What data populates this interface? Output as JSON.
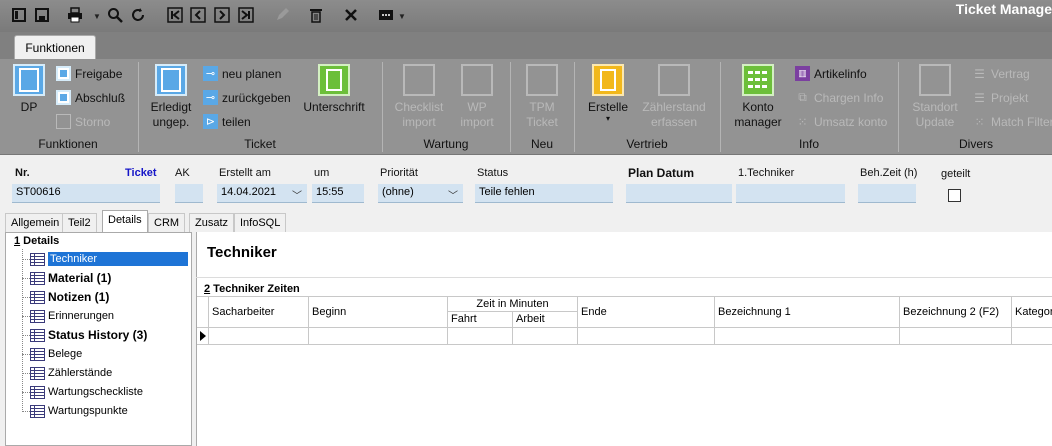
{
  "window": {
    "title": "Ticket Manage"
  },
  "quick_access": [
    {
      "name": "close-doc-icon"
    },
    {
      "name": "save-icon"
    },
    {
      "name": "print-icon"
    },
    {
      "name": "search-icon"
    },
    {
      "name": "refresh-icon"
    },
    {
      "name": "first-icon"
    },
    {
      "name": "prev-icon"
    },
    {
      "name": "next-icon"
    },
    {
      "name": "last-icon"
    },
    {
      "name": "edit-icon"
    },
    {
      "name": "delete-icon"
    },
    {
      "name": "close-icon"
    },
    {
      "name": "more-icon"
    }
  ],
  "ribbon": {
    "tab_label": "Funktionen",
    "groups": {
      "funktionen": {
        "label": "Funktionen",
        "dp": "DP",
        "freigabe": "Freigabe",
        "abschluss": "Abschluß",
        "storno": "Storno"
      },
      "ticket": {
        "label": "Ticket",
        "erledigt_1": "Erledigt",
        "erledigt_2": "ungep.",
        "neu_planen": "neu planen",
        "zurueckgeben": "zurückgeben",
        "teilen": "teilen",
        "unterschrift": "Unterschrift"
      },
      "wartung": {
        "label": "Wartung",
        "checklist_1": "Checklist",
        "checklist_2": "import",
        "wp_1": "WP",
        "wp_2": "import"
      },
      "neu": {
        "label": "Neu",
        "tpm_1": "TPM",
        "tpm_2": "Ticket"
      },
      "vertrieb": {
        "label": "Vertrieb",
        "erstelle": "Erstelle",
        "erstelle_arrow": "▾",
        "zaehler_1": "Zählerstand",
        "zaehler_2": "erfassen"
      },
      "info": {
        "label": "Info",
        "konto_1": "Konto",
        "konto_2": "manager",
        "artikelinfo": "Artikelinfo",
        "chargen": "Chargen Info",
        "umsatz": "Umsatz konto"
      },
      "divers": {
        "label": "Divers",
        "standort_1": "Standort",
        "standort_2": "Update",
        "vertrag": "Vertrag",
        "projekt": "Projekt",
        "match": "Match Filter"
      }
    }
  },
  "header": {
    "nr_label": "Nr.",
    "nr_value": "ST00616",
    "ticket_label": "Ticket",
    "ak_label": "AK",
    "ak_value": "",
    "erstellt_label": "Erstellt am",
    "erstellt_value": "14.04.2021",
    "um_label": "um",
    "um_value": "15:55",
    "prio_label": "Priorität",
    "prio_value": "(ohne)",
    "status_label": "Status",
    "status_value": "Teile fehlen",
    "plan_label": "Plan Datum",
    "plan_value": "",
    "techniker_label": "1.Techniker",
    "techniker_value": "",
    "behzeit_label": "Beh.Zeit (h)",
    "behzeit_value": "",
    "geteilt_label": "geteilt"
  },
  "tabs": [
    "Allgemein",
    "Teil2",
    "Details",
    "CRM",
    "Zusatz",
    "InfoSQL"
  ],
  "tree": {
    "title_num": "1",
    "title": " Details",
    "items": [
      {
        "label": "Techniker"
      },
      {
        "label": "Material (1)"
      },
      {
        "label": "Notizen (1)"
      },
      {
        "label": "Erinnerungen"
      },
      {
        "label": "Status History (3)"
      },
      {
        "label": "Belege"
      },
      {
        "label": "Zählerstände"
      },
      {
        "label": "Wartungscheckliste"
      },
      {
        "label": "Wartungspunkte"
      }
    ]
  },
  "main": {
    "title": "Techniker",
    "section_num": "2",
    "section_title": " Techniker Zeiten",
    "grid": {
      "sacharbeiter": "Sacharbeiter",
      "beginn": "Beginn",
      "zeit_group": "Zeit in Minuten",
      "fahrt": "Fahrt",
      "arbeit": "Arbeit",
      "ende": "Ende",
      "bez1": "Bezeichnung 1",
      "bez2": "Bezeichnung 2 (F2)",
      "kategorie": "Kategor"
    }
  }
}
